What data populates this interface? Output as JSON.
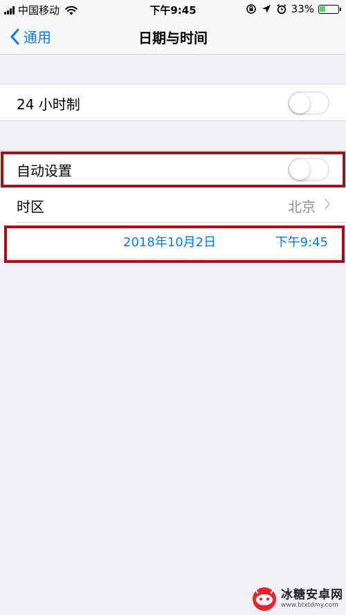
{
  "status_bar": {
    "carrier": "中国移动",
    "time": "下午9:45",
    "battery_percent_text": "33%",
    "battery_level": 0.33,
    "battery_color": "#4cd964"
  },
  "nav": {
    "back_label": "通用",
    "title": "日期与时间"
  },
  "settings": {
    "hour24_label": "24 小时制",
    "hour24_on": false,
    "auto_set_label": "自动设置",
    "auto_set_on": false,
    "timezone_label": "时区",
    "timezone_value": "北京",
    "date_value": "2018年10月2日",
    "time_value": "下午9:45"
  },
  "icons": {
    "signal": "cell-signal-icon",
    "wifi": "wifi-icon",
    "rotation_lock": "rotation-lock-icon",
    "location": "location-arrow-icon",
    "alarm": "alarm-clock-icon",
    "back": "chevron-left-icon",
    "disclosure": "chevron-right-icon"
  },
  "colors": {
    "accent": "#007aff",
    "highlight": "#a50f15",
    "background": "#efeff4"
  },
  "watermark": {
    "name": "冰糖安卓网",
    "url": "www.btxtdmy.com"
  }
}
